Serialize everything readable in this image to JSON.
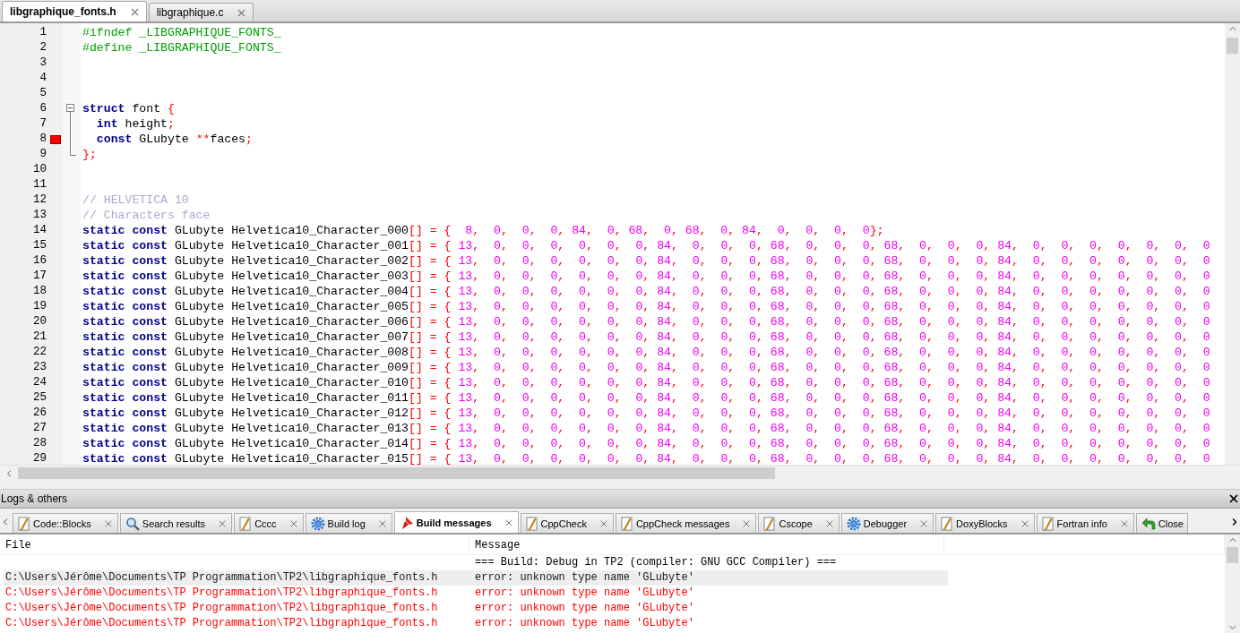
{
  "editor_tabs": [
    {
      "label": "libgraphique_fonts.h",
      "selected": true
    },
    {
      "label": "libgraphique.c",
      "selected": false
    }
  ],
  "code_lines": [
    {
      "number": "1",
      "tokens": [
        {
          "kind": "preproc",
          "text": "#ifndef _LIBGRAPHIQUE_FONTS_"
        }
      ]
    },
    {
      "number": "2",
      "tokens": [
        {
          "kind": "preproc",
          "text": "#define _LIBGRAPHIQUE_FONTS_"
        }
      ]
    },
    {
      "number": "3"
    },
    {
      "number": "4"
    },
    {
      "number": "5"
    },
    {
      "number": "6",
      "fold_toggle": true,
      "tokens": [
        {
          "kind": "keyword",
          "text": "struct"
        },
        {
          "kind": "plain",
          "text": " font "
        },
        {
          "kind": "operator",
          "text": "{"
        }
      ]
    },
    {
      "number": "7",
      "fold_line": true,
      "tokens": [
        {
          "kind": "keyword",
          "text": "  int"
        },
        {
          "kind": "plain",
          "text": " height"
        },
        {
          "kind": "operator",
          "text": ";"
        }
      ]
    },
    {
      "number": "8",
      "fold_line": true,
      "error_marker": true,
      "tokens": [
        {
          "kind": "keyword",
          "text": "  const"
        },
        {
          "kind": "plain",
          "text": " GLubyte "
        },
        {
          "kind": "operator",
          "text": "**"
        },
        {
          "kind": "plain",
          "text": "faces"
        },
        {
          "kind": "operator",
          "text": ";"
        }
      ]
    },
    {
      "number": "9",
      "fold_end": true,
      "tokens": [
        {
          "kind": "operator",
          "text": "};"
        }
      ]
    },
    {
      "number": "10"
    },
    {
      "number": "11"
    },
    {
      "number": "12",
      "tokens": [
        {
          "kind": "comment",
          "text": "// HELVETICA 10"
        }
      ]
    },
    {
      "number": "13",
      "tokens": [
        {
          "kind": "comment",
          "text": "// Characters face"
        }
      ]
    },
    {
      "number": "14",
      "tokens": [
        {
          "kind": "keyword",
          "text": "static const"
        },
        {
          "kind": "plain",
          "text": " GLubyte Helvetica10_Character_000"
        },
        {
          "kind": "operator",
          "text": "[] = {"
        },
        {
          "kind": "number",
          "text": "  8,  0,  0,  0, 84,  0, 68,  0, 68,  0, 84,  0,  0,  0,  0"
        },
        {
          "kind": "operator",
          "text": "};"
        }
      ]
    },
    {
      "number": "15",
      "tokens": [
        {
          "kind": "keyword",
          "text": "static const"
        },
        {
          "kind": "plain",
          "text": " GLubyte Helvetica10_Character_001"
        },
        {
          "kind": "operator",
          "text": "[] = {"
        },
        {
          "kind": "number",
          "text": " 13,  0,  0,  0,  0,  0,  0, 84,  0,  0,  0, 68,  0,  0,  0, 68,  0,  0,  0, 84,  0,  0,  0,  0,  0,  0,  0"
        }
      ]
    },
    {
      "number": "16",
      "tokens": [
        {
          "kind": "keyword",
          "text": "static const"
        },
        {
          "kind": "plain",
          "text": " GLubyte Helvetica10_Character_002"
        },
        {
          "kind": "operator",
          "text": "[] = {"
        },
        {
          "kind": "number",
          "text": " 13,  0,  0,  0,  0,  0,  0, 84,  0,  0,  0, 68,  0,  0,  0, 68,  0,  0,  0, 84,  0,  0,  0,  0,  0,  0,  0"
        }
      ]
    },
    {
      "number": "17",
      "tokens": [
        {
          "kind": "keyword",
          "text": "static const"
        },
        {
          "kind": "plain",
          "text": " GLubyte Helvetica10_Character_003"
        },
        {
          "kind": "operator",
          "text": "[] = {"
        },
        {
          "kind": "number",
          "text": " 13,  0,  0,  0,  0,  0,  0, 84,  0,  0,  0, 68,  0,  0,  0, 68,  0,  0,  0, 84,  0,  0,  0,  0,  0,  0,  0"
        }
      ]
    },
    {
      "number": "18",
      "tokens": [
        {
          "kind": "keyword",
          "text": "static const"
        },
        {
          "kind": "plain",
          "text": " GLubyte Helvetica10_Character_004"
        },
        {
          "kind": "operator",
          "text": "[] = {"
        },
        {
          "kind": "number",
          "text": " 13,  0,  0,  0,  0,  0,  0, 84,  0,  0,  0, 68,  0,  0,  0, 68,  0,  0,  0, 84,  0,  0,  0,  0,  0,  0,  0"
        }
      ]
    },
    {
      "number": "19",
      "tokens": [
        {
          "kind": "keyword",
          "text": "static const"
        },
        {
          "kind": "plain",
          "text": " GLubyte Helvetica10_Character_005"
        },
        {
          "kind": "operator",
          "text": "[] = {"
        },
        {
          "kind": "number",
          "text": " 13,  0,  0,  0,  0,  0,  0, 84,  0,  0,  0, 68,  0,  0,  0, 68,  0,  0,  0, 84,  0,  0,  0,  0,  0,  0,  0"
        }
      ]
    },
    {
      "number": "20",
      "tokens": [
        {
          "kind": "keyword",
          "text": "static const"
        },
        {
          "kind": "plain",
          "text": " GLubyte Helvetica10_Character_006"
        },
        {
          "kind": "operator",
          "text": "[] = {"
        },
        {
          "kind": "number",
          "text": " 13,  0,  0,  0,  0,  0,  0, 84,  0,  0,  0, 68,  0,  0,  0, 68,  0,  0,  0, 84,  0,  0,  0,  0,  0,  0,  0"
        }
      ]
    },
    {
      "number": "21",
      "tokens": [
        {
          "kind": "keyword",
          "text": "static const"
        },
        {
          "kind": "plain",
          "text": " GLubyte Helvetica10_Character_007"
        },
        {
          "kind": "operator",
          "text": "[] = {"
        },
        {
          "kind": "number",
          "text": " 13,  0,  0,  0,  0,  0,  0, 84,  0,  0,  0, 68,  0,  0,  0, 68,  0,  0,  0, 84,  0,  0,  0,  0,  0,  0,  0"
        }
      ]
    },
    {
      "number": "22",
      "tokens": [
        {
          "kind": "keyword",
          "text": "static const"
        },
        {
          "kind": "plain",
          "text": " GLubyte Helvetica10_Character_008"
        },
        {
          "kind": "operator",
          "text": "[] = {"
        },
        {
          "kind": "number",
          "text": " 13,  0,  0,  0,  0,  0,  0, 84,  0,  0,  0, 68,  0,  0,  0, 68,  0,  0,  0, 84,  0,  0,  0,  0,  0,  0,  0"
        }
      ]
    },
    {
      "number": "23",
      "tokens": [
        {
          "kind": "keyword",
          "text": "static const"
        },
        {
          "kind": "plain",
          "text": " GLubyte Helvetica10_Character_009"
        },
        {
          "kind": "operator",
          "text": "[] = {"
        },
        {
          "kind": "number",
          "text": " 13,  0,  0,  0,  0,  0,  0, 84,  0,  0,  0, 68,  0,  0,  0, 68,  0,  0,  0, 84,  0,  0,  0,  0,  0,  0,  0"
        }
      ]
    },
    {
      "number": "24",
      "tokens": [
        {
          "kind": "keyword",
          "text": "static const"
        },
        {
          "kind": "plain",
          "text": " GLubyte Helvetica10_Character_010"
        },
        {
          "kind": "operator",
          "text": "[] = {"
        },
        {
          "kind": "number",
          "text": " 13,  0,  0,  0,  0,  0,  0, 84,  0,  0,  0, 68,  0,  0,  0, 68,  0,  0,  0, 84,  0,  0,  0,  0,  0,  0,  0"
        }
      ]
    },
    {
      "number": "25",
      "tokens": [
        {
          "kind": "keyword",
          "text": "static const"
        },
        {
          "kind": "plain",
          "text": " GLubyte Helvetica10_Character_011"
        },
        {
          "kind": "operator",
          "text": "[] = {"
        },
        {
          "kind": "number",
          "text": " 13,  0,  0,  0,  0,  0,  0, 84,  0,  0,  0, 68,  0,  0,  0, 68,  0,  0,  0, 84,  0,  0,  0,  0,  0,  0,  0"
        }
      ]
    },
    {
      "number": "26",
      "tokens": [
        {
          "kind": "keyword",
          "text": "static const"
        },
        {
          "kind": "plain",
          "text": " GLubyte Helvetica10_Character_012"
        },
        {
          "kind": "operator",
          "text": "[] = {"
        },
        {
          "kind": "number",
          "text": " 13,  0,  0,  0,  0,  0,  0, 84,  0,  0,  0, 68,  0,  0,  0, 68,  0,  0,  0, 84,  0,  0,  0,  0,  0,  0,  0"
        }
      ]
    },
    {
      "number": "27",
      "tokens": [
        {
          "kind": "keyword",
          "text": "static const"
        },
        {
          "kind": "plain",
          "text": " GLubyte Helvetica10_Character_013"
        },
        {
          "kind": "operator",
          "text": "[] = {"
        },
        {
          "kind": "number",
          "text": " 13,  0,  0,  0,  0,  0,  0, 84,  0,  0,  0, 68,  0,  0,  0, 68,  0,  0,  0, 84,  0,  0,  0,  0,  0,  0,  0"
        }
      ]
    },
    {
      "number": "28",
      "tokens": [
        {
          "kind": "keyword",
          "text": "static const"
        },
        {
          "kind": "plain",
          "text": " GLubyte Helvetica10_Character_014"
        },
        {
          "kind": "operator",
          "text": "[] = {"
        },
        {
          "kind": "number",
          "text": " 13,  0,  0,  0,  0,  0,  0, 84,  0,  0,  0, 68,  0,  0,  0, 68,  0,  0,  0, 84,  0,  0,  0,  0,  0,  0,  0"
        }
      ]
    },
    {
      "number": "29",
      "tokens": [
        {
          "kind": "keyword",
          "text": "static const"
        },
        {
          "kind": "plain",
          "text": " GLubyte Helvetica10_Character_015"
        },
        {
          "kind": "operator",
          "text": "[] = {"
        },
        {
          "kind": "number",
          "text": " 13,  0,  0,  0,  0,  0,  0, 84,  0,  0,  0, 68,  0,  0,  0, 68,  0,  0,  0, 84,  0,  0,  0,  0,  0,  0,  0"
        }
      ]
    }
  ],
  "logs_panel": {
    "title": "Logs & others",
    "tabs": [
      {
        "label": "Code::Blocks",
        "kind": "note",
        "selected": false
      },
      {
        "label": "Search results",
        "kind": "search",
        "selected": false
      },
      {
        "label": "Cccc",
        "kind": "note",
        "selected": false
      },
      {
        "label": "Build log",
        "kind": "gear",
        "selected": false
      },
      {
        "label": "Build messages",
        "kind": "pin",
        "selected": true
      },
      {
        "label": "CppCheck",
        "kind": "note",
        "selected": false
      },
      {
        "label": "CppCheck messages",
        "kind": "note",
        "selected": false
      },
      {
        "label": "Cscope",
        "kind": "note",
        "selected": false
      },
      {
        "label": "Debugger",
        "kind": "gear",
        "selected": false
      },
      {
        "label": "DoxyBlocks",
        "kind": "note",
        "selected": false
      },
      {
        "label": "Fortran info",
        "kind": "note",
        "selected": false
      },
      {
        "label": "Close",
        "kind": "arrow",
        "selected": false
      }
    ],
    "table": {
      "columns": [
        "File",
        "Message"
      ],
      "rows": [
        {
          "message": "=== Build: Debug in TP2 (compiler: GNU GCC Compiler) ===",
          "kind": "info",
          "selected": false
        },
        {
          "file": "C:\\Users\\Jérôme\\Documents\\TP Programmation\\TP2\\libgraphique_fonts.h",
          "message": "error: unknown type name 'GLubyte'",
          "kind": "error",
          "selected": true
        },
        {
          "file": "C:\\Users\\Jérôme\\Documents\\TP Programmation\\TP2\\libgraphique_fonts.h",
          "message": "error: unknown type name 'GLubyte'",
          "kind": "error",
          "selected": false
        },
        {
          "file": "C:\\Users\\Jérôme\\Documents\\TP Programmation\\TP2\\libgraphique_fonts.h",
          "message": "error: unknown type name 'GLubyte'",
          "kind": "error",
          "selected": false
        },
        {
          "file": "C:\\Users\\Jérôme\\Documents\\TP Programmation\\TP2\\libgraphique_fonts.h",
          "message": "error: unknown type name 'GLubyte'",
          "kind": "error",
          "selected": false
        }
      ]
    }
  }
}
